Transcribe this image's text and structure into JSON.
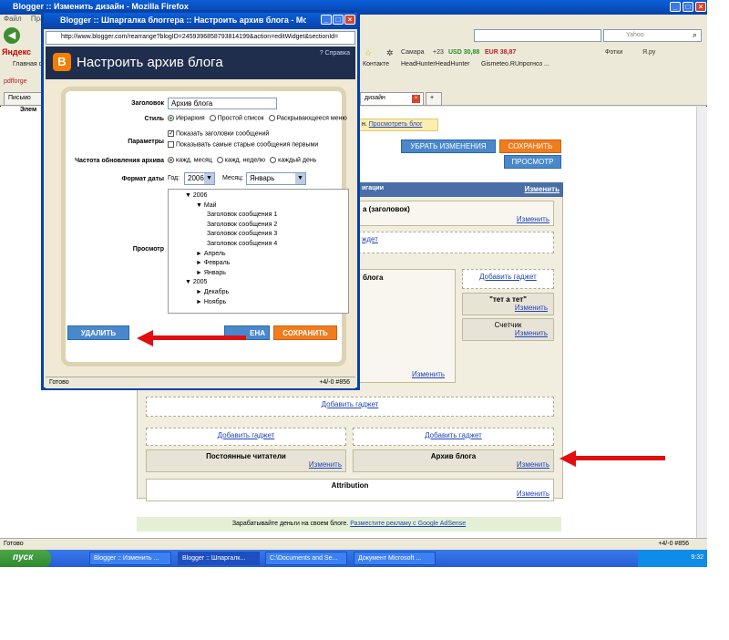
{
  "bg_window": {
    "title": "Blogger :: Изменить дизайн - Mozilla Firefox",
    "menu": [
      "Файл",
      "Правка"
    ],
    "search_placeholder": "Yahoo",
    "yandex_logo": "Яндекс",
    "yandex_bar": {
      "region": "Самара",
      "weather": "+23",
      "usd": "USD 30,88",
      "eur": "EUR 38,87",
      "fotki": "Фотки",
      "yaru": "Я.ру"
    },
    "bookmarks": [
      "Главная с",
      "Контакте",
      "HeadHunterHeadHunter",
      "Gismeteo.RUпрогноз ..."
    ],
    "pdfforge": "pdfforge",
    "bg_tabs": [
      "Письмо",
      "дизайн"
    ],
    "items_label": "Элем",
    "view_blog_prefix": "н.",
    "view_blog_link": "Просмотреть блог",
    "status": "Готово",
    "status_right": "+4/-0   #856"
  },
  "editor": {
    "clear_changes": "УБРАТЬ ИЗМЕНЕНИЯ",
    "save": "СОХРАНИТЬ",
    "preview": "ПРОСМОТР",
    "nav_label": "игации",
    "edit": "Изменить",
    "header_gadget": "а (заголовок)",
    "add_gadget": "Добавить гаджет",
    "add_gadget_partial": "ждет",
    "blog_posts": "блога",
    "tet_a_tet": "\"тет а тет\"",
    "counter": "Счетчик",
    "followers": "Постоянные читатели",
    "blog_archive": "Архив блога",
    "attribution": "Attribution",
    "adsense_prefix": "Зарабатывайте деньги на своем блоге.",
    "adsense_link": "Разместите рекламу с Google AdSense"
  },
  "popup": {
    "title": "Blogger :: Шпаргалка блоггера :: Настроить архив блога - Mozilla Firefox",
    "url": "http://www.blogger.com/rearrange?blogID=2459396858793814199&action=editWidget&sectionId=",
    "header_title": "Настроить архив блога",
    "help": "Справка",
    "labels": {
      "title": "Заголовок",
      "style": "Стиль",
      "options": "Параметры",
      "frequency": "Частота обновления архива",
      "date_format": "Формат даты",
      "preview": "Просмотр"
    },
    "title_value": "Архив блога",
    "style_options": [
      "Иерархия",
      "Простой список",
      "Раскрывающееся меню"
    ],
    "checkboxes": [
      "Показать заголовки сообщений",
      "Показывать самые старые сообщения первыми"
    ],
    "frequency_options": [
      "кажд. месяц",
      "кажд. неделю",
      "каждый день"
    ],
    "year_label": "Год:",
    "year_value": "2006",
    "month_label": "Месяц:",
    "month_value": "Январь",
    "tree": [
      {
        "indent": 0,
        "text": "▼ 2006"
      },
      {
        "indent": 1,
        "text": "▼ Май"
      },
      {
        "indent": 2,
        "text": "Заголовок сообщения 1"
      },
      {
        "indent": 2,
        "text": "Заголовок сообщения 2"
      },
      {
        "indent": 2,
        "text": "Заголовок сообщения 3"
      },
      {
        "indent": 2,
        "text": "Заголовок сообщения 4"
      },
      {
        "indent": 1,
        "text": "► Апрель"
      },
      {
        "indent": 1,
        "text": "► Февраль"
      },
      {
        "indent": 1,
        "text": "► Январь"
      },
      {
        "indent": 0,
        "text": "▼ 2005"
      },
      {
        "indent": 1,
        "text": "► Декабрь"
      },
      {
        "indent": 1,
        "text": "► Ноябрь"
      }
    ],
    "delete_btn": "УДАЛИТЬ",
    "cancel_btn": "ЕНА",
    "save_btn": "СОХРАНИТЬ",
    "status": "Готово",
    "status_right": "+4/-0   #856"
  },
  "taskbar": {
    "start": "пуск",
    "items": [
      "Blogger :: Изменить ...",
      "Blogger :: Шпаргалк...",
      "C:\\Documents and Se...",
      "Документ Microsoft ..."
    ],
    "time": "9:32"
  },
  "colors": {
    "arrow": "#e01010",
    "blogger_orange": "#f57d00",
    "xp_blue": "#0842a8"
  }
}
